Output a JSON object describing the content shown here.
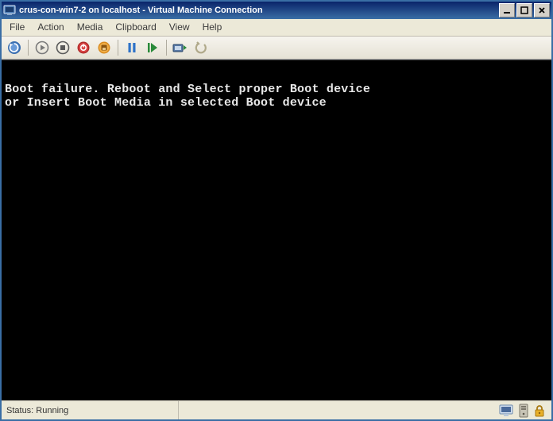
{
  "window": {
    "title": "crus-con-win7-2 on localhost - Virtual Machine Connection"
  },
  "menu": {
    "file": "File",
    "action": "Action",
    "media": "Media",
    "clipboard": "Clipboard",
    "view": "View",
    "help": "Help"
  },
  "toolbar": {
    "ctrl_alt_del": "Ctrl-Alt-Del",
    "start": "Start",
    "turn_off": "Turn Off",
    "shutdown": "Shut Down",
    "save": "Save",
    "pause": "Pause",
    "reset": "Reset",
    "snapshot": "Snapshot",
    "revert": "Revert"
  },
  "console": {
    "text": "Boot failure. Reboot and Select proper Boot device\nor Insert Boot Media in selected Boot device"
  },
  "status": {
    "label": "Status: Running"
  }
}
